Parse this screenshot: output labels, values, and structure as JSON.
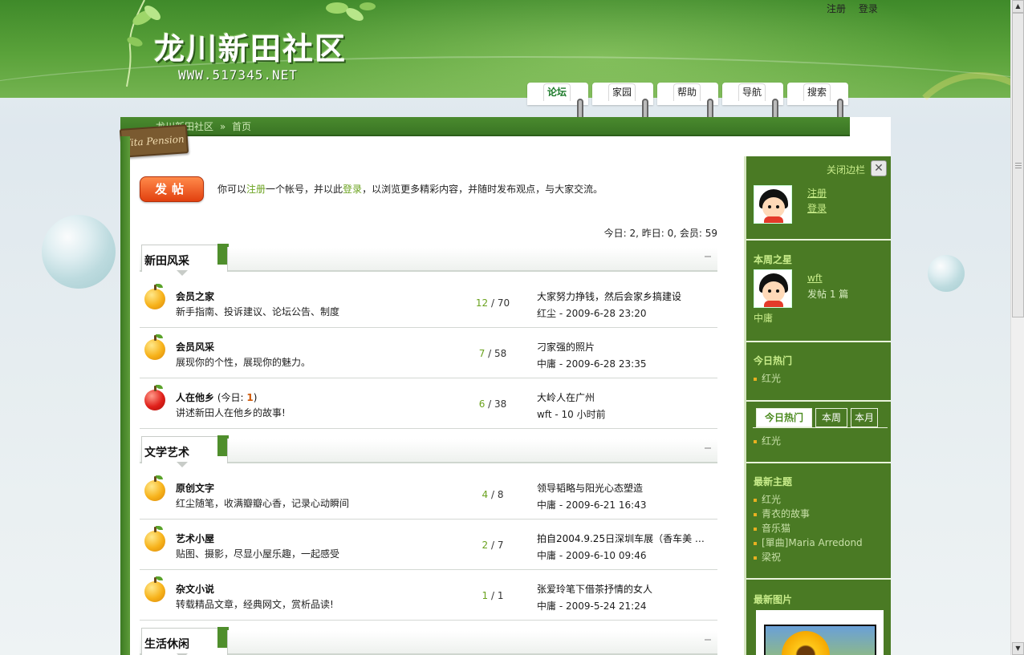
{
  "site": {
    "title": "龙川新田社区",
    "url": "WWW.517345.NET"
  },
  "top_links": {
    "register": "注册",
    "login": "登录"
  },
  "nav": [
    {
      "label": "论坛",
      "active": true
    },
    {
      "label": "家园",
      "active": false
    },
    {
      "label": "帮助",
      "active": false
    },
    {
      "label": "导航",
      "active": false
    },
    {
      "label": "搜索",
      "active": false
    }
  ],
  "breadcrumb": {
    "home": "龙川新田社区",
    "sep": "»",
    "current": "首页",
    "sign": "Vita Pension"
  },
  "post_button": "发帖",
  "welcome": {
    "pre": "你可以",
    "register": "注册",
    "mid": "一个帐号，并以此",
    "login": "登录",
    "post": "，以浏览更多精彩内容，并随时发布观点，与大家交流。"
  },
  "stats": "今日: 2, 昨日: 0, 会员: 59",
  "categories": [
    {
      "title": "新田风采"
    },
    {
      "title": "文学艺术"
    },
    {
      "title": "生活休闲"
    }
  ],
  "forums": [
    {
      "name": "会员之家",
      "today_pre": "",
      "today_num": "",
      "today_post": "",
      "desc": "新手指南、投诉建议、论坛公告、制度",
      "topics": "12",
      "slash": " / ",
      "posts": "70",
      "last_title": "大家努力挣钱，然后会家乡搞建设",
      "last_meta": "红尘  - 2009-6-28 23:20",
      "fruit": "orange"
    },
    {
      "name": "会员风采",
      "today_pre": "",
      "today_num": "",
      "today_post": "",
      "desc": "展现你的个性，展现你的魅力。",
      "topics": "7",
      "slash": " / ",
      "posts": "58",
      "last_title": "刁家强的照片",
      "last_meta": "中庸  - 2009-6-28 23:35",
      "fruit": "orange"
    },
    {
      "name": "人在他乡",
      "today_pre": " (今日: ",
      "today_num": "1",
      "today_post": ")",
      "desc": "讲述新田人在他乡的故事!",
      "topics": "6",
      "slash": " / ",
      "posts": "38",
      "last_title": "大岭人在广州",
      "last_meta": "wft  - 10 小时前",
      "fruit": "red"
    },
    {
      "name": "原创文字",
      "today_pre": "",
      "today_num": "",
      "today_post": "",
      "desc": "红尘随笔，收满瓣瓣心香，记录心动瞬间",
      "topics": "4",
      "slash": " / ",
      "posts": "8",
      "last_title": "领导韬略与阳光心态塑造",
      "last_meta": "中庸  - 2009-6-21 16:43",
      "fruit": "orange"
    },
    {
      "name": "艺术小屋",
      "today_pre": "",
      "today_num": "",
      "today_post": "",
      "desc": "贴图、摄影，尽显小屋乐趣，一起感受",
      "topics": "2",
      "slash": " / ",
      "posts": "7",
      "last_title": "拍自2004.9.25日深圳车展（香车美 …",
      "last_meta": "中庸  - 2009-6-10 09:46",
      "fruit": "orange"
    },
    {
      "name": "杂文小说",
      "today_pre": "",
      "today_num": "",
      "today_post": "",
      "desc": "转载精品文章，经典网文，赏析品读!",
      "topics": "1",
      "slash": " / ",
      "posts": "1",
      "last_title": "张爱玲笔下借茶抒情的女人",
      "last_meta": "中庸  - 2009-5-24 21:24",
      "fruit": "orange"
    }
  ],
  "sidebar": {
    "close_label": "关闭边栏",
    "close_x": "✕",
    "register": "注册",
    "login": "登录",
    "star_title": "本周之星",
    "star_user": "wft",
    "star_posts": "发帖  1 篇",
    "star_extra": "中庸",
    "today_hot_title": "今日热门",
    "today_hot_items": [
      "红光"
    ],
    "hot_tabs": [
      "今日热门",
      "本周",
      "本月"
    ],
    "hot_tab_items": [
      "红光"
    ],
    "latest_title": "最新主题",
    "latest_items": [
      "红光",
      "青衣的故事",
      "音乐猫",
      "[單曲]Maria Arredond",
      "梁祝"
    ],
    "pics_title": "最新图片"
  },
  "colors": {
    "brand_green": "#4a7a24",
    "link_green": "#6aa21e",
    "post_button": "#e2400f"
  }
}
